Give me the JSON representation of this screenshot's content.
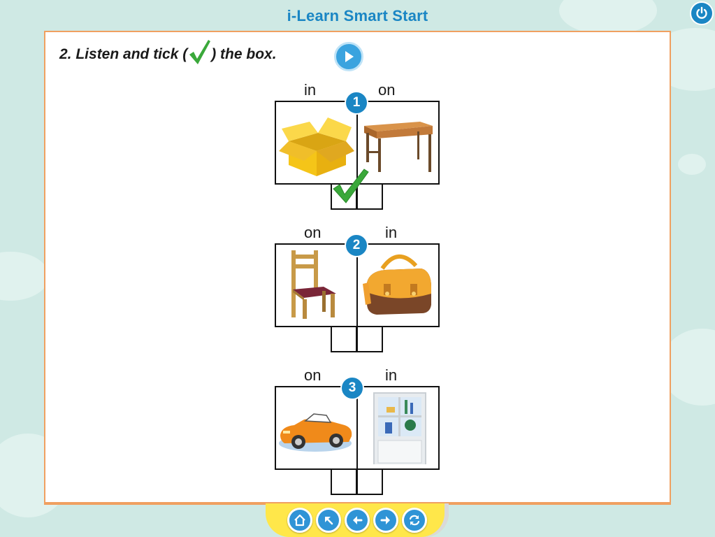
{
  "app": {
    "title": "i-Learn Smart Start"
  },
  "exercise": {
    "instruction_before": "2. Listen and tick (",
    "instruction_after": ") the box.",
    "items": [
      {
        "number": "1",
        "left_word": "in",
        "right_word": "on",
        "left_picture": "box-picture",
        "right_picture": "desk-picture",
        "ticked": "left"
      },
      {
        "number": "2",
        "left_word": "on",
        "right_word": "in",
        "left_picture": "chair-picture",
        "right_picture": "bag-picture",
        "ticked": "none"
      },
      {
        "number": "3",
        "left_word": "on",
        "right_word": "in",
        "left_picture": "car-picture",
        "right_picture": "bookcase-picture",
        "ticked": "none"
      }
    ]
  },
  "toolbar": {
    "icons": [
      "power-icon",
      "play-icon",
      "home-icon",
      "up-left-arrow-icon",
      "back-arrow-icon",
      "forward-arrow-icon",
      "refresh-icon"
    ]
  },
  "colors": {
    "accent": "#1a86c4",
    "panel_border": "#f0a060",
    "tick": "#3aa83a",
    "nav_bar": "#ffe74a"
  }
}
